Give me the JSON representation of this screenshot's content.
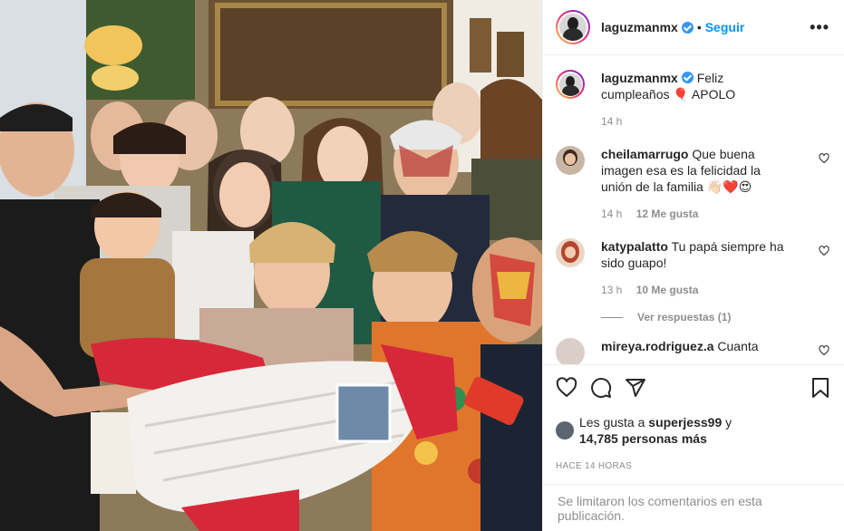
{
  "header": {
    "username": "laguzmanmx",
    "separator": "•",
    "follow_label": "Seguir",
    "more_label": "•••"
  },
  "caption": {
    "username": "laguzmanmx",
    "text": "Feliz cumpleaños 🎈 APOLO",
    "age": "14 h"
  },
  "comments": [
    {
      "username": "cheilamarrugo",
      "text": "Que buena imagen esa es la felicidad la unión de la familia 👋🏻❤️😍",
      "age": "14 h",
      "likes": "12 Me gusta"
    },
    {
      "username": "katypalatto",
      "text": "Tu papá siempre ha sido guapo!",
      "age": "13 h",
      "likes": "10 Me gusta",
      "replies_label": "Ver respuestas (1)"
    },
    {
      "username": "mireya.rodriguez.a",
      "text": "Cuanta"
    }
  ],
  "likes": {
    "prefix": "Les gusta a",
    "user": "superjess99",
    "conj": "y",
    "others": "14,785 personas más"
  },
  "timestamp": "HACE 14 HORAS",
  "footer": {
    "comments_limited": "Se limitaron los comentarios en esta publicación."
  },
  "icons": {
    "like": "heart-icon",
    "comment": "comment-icon",
    "share": "share-icon",
    "save": "bookmark-icon",
    "verified": "verified-badge-icon"
  },
  "colors": {
    "accent": "#0095f6",
    "verified": "#3897f0",
    "muted": "#8e8e8e"
  }
}
